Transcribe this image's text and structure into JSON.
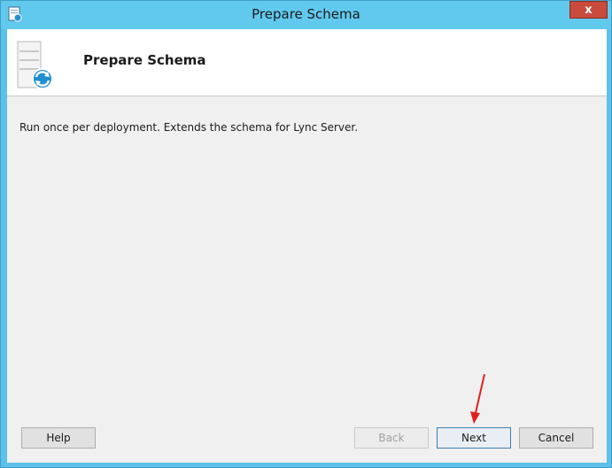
{
  "window": {
    "title": "Prepare Schema",
    "close_label": "x"
  },
  "header": {
    "title": "Prepare Schema",
    "icon": "server-sync-icon"
  },
  "content": {
    "description": "Run once per deployment.  Extends the schema for Lync Server."
  },
  "buttons": {
    "help": "Help",
    "back": "Back",
    "next": "Next",
    "cancel": "Cancel"
  },
  "annotation": {
    "arrow_color": "#e02020"
  }
}
